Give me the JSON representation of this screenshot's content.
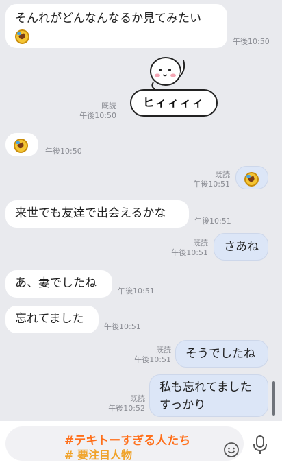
{
  "chat": {
    "m1": {
      "text": "そんれがどんなんなるか見てみたい",
      "time": "午後10:50"
    },
    "sticker": {
      "read": "既読",
      "time": "午後10:50",
      "text": "ヒィィィィ"
    },
    "m3": {
      "time": "午後10:50"
    },
    "m4": {
      "read": "既読",
      "time": "午後10:51"
    },
    "m5": {
      "text": "来世でも友達で出会えるかな",
      "time": "午後10:51"
    },
    "m6": {
      "text": "さあね",
      "read": "既読",
      "time": "午後10:51"
    },
    "m7": {
      "text": "あ、妻でしたね",
      "time": "午後10:51"
    },
    "m8": {
      "text": "忘れてました",
      "time": "午後10:51"
    },
    "m9": {
      "text": "そうでしたね",
      "read": "既読",
      "time": "午後10:51"
    },
    "m10": {
      "line1": "私も忘れてました",
      "line2": "すっかり",
      "read": "既読",
      "time": "午後10:52"
    }
  },
  "input": {
    "tag1": "#テキトーすぎる人たち",
    "tag2": "# 要注目人物"
  },
  "icons": [
    "laughing-emoji-icon",
    "smiley-face-icon",
    "microphone-icon"
  ],
  "colors": {
    "background": "#e9eaee",
    "outgoing": "#dce6f7",
    "incoming": "#ffffff",
    "tag1": "#ff6f1a",
    "tag2": "#f0a32a"
  }
}
